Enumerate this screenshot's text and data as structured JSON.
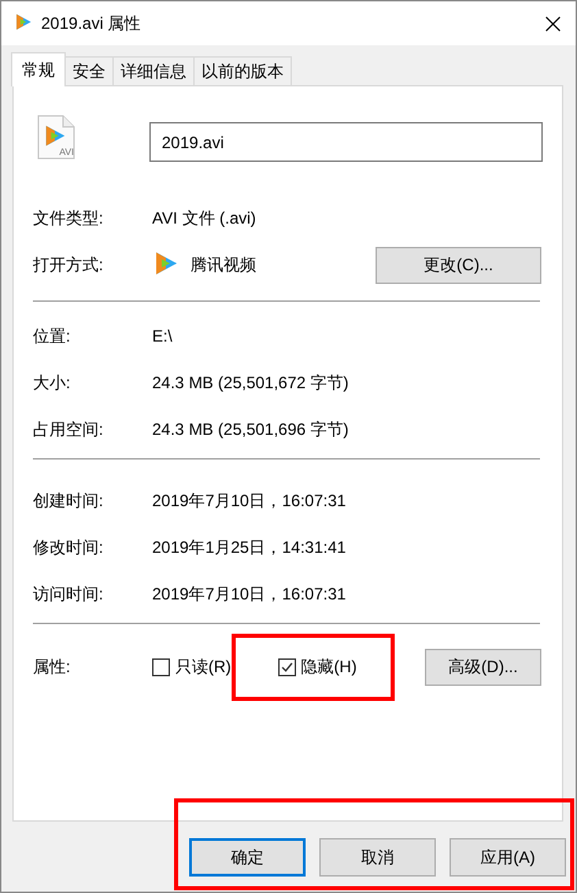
{
  "window": {
    "title": "2019.avi 属性"
  },
  "tabs": [
    {
      "label": "常规",
      "selected": true
    },
    {
      "label": "安全",
      "selected": false
    },
    {
      "label": "详细信息",
      "selected": false
    },
    {
      "label": "以前的版本",
      "selected": false
    }
  ],
  "file": {
    "name": "2019.avi",
    "icon_caption": "AVI"
  },
  "type_row": {
    "label": "文件类型:",
    "value": "AVI 文件 (.avi)"
  },
  "open_with": {
    "label": "打开方式:",
    "app": "腾讯视频",
    "button": "更改(C)..."
  },
  "location_rows": [
    {
      "label": "位置:",
      "value": "E:\\"
    },
    {
      "label": "大小:",
      "value": "24.3 MB (25,501,672 字节)"
    },
    {
      "label": "占用空间:",
      "value": "24.3 MB (25,501,696 字节)"
    }
  ],
  "time_rows": [
    {
      "label": "创建时间:",
      "value": "2019年7月10日，16:07:31"
    },
    {
      "label": "修改时间:",
      "value": "2019年1月25日，14:31:41"
    },
    {
      "label": "访问时间:",
      "value": "2019年7月10日，16:07:31"
    }
  ],
  "attributes": {
    "label": "属性:",
    "readonly": {
      "label": "只读(R)",
      "checked": false
    },
    "hidden": {
      "label": "隐藏(H)",
      "checked": true,
      "highlighted": true
    },
    "button": "高级(D)..."
  },
  "button_bar": {
    "highlighted": true,
    "buttons": [
      {
        "label": "确定",
        "default": true
      },
      {
        "label": "取消",
        "default": false
      },
      {
        "label": "应用(A)",
        "default": false
      }
    ]
  }
}
